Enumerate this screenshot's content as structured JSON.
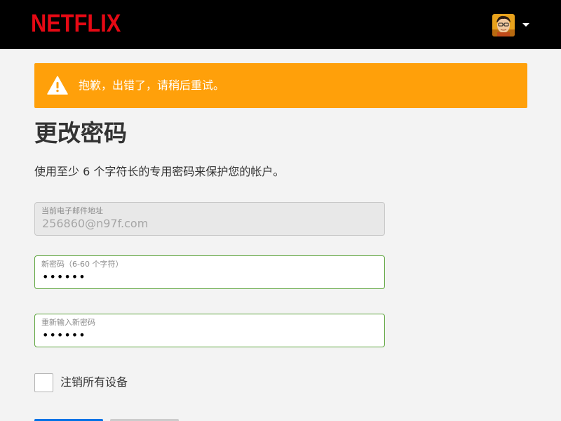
{
  "header": {
    "logo_text": "NETFLIX",
    "logo_color": "#e50914",
    "avatar_icon": "profile-avatar",
    "caret_icon": "caret-down-icon"
  },
  "alert": {
    "icon": "warning-icon",
    "message": "抱歉，出错了，请稍后重试。",
    "color": "#ffa00a"
  },
  "page": {
    "title": "更改密码",
    "subtitle": "使用至少 6 个字符长的专用密码来保护您的帐户。"
  },
  "form": {
    "email_label": "当前电子邮件地址",
    "email_value": "256860@n97f.com",
    "new_password_label": "新密码（6-60 个字符）",
    "new_password_value": "••••••",
    "confirm_password_label": "重新输入新密码",
    "confirm_password_value": "••••••",
    "signout_all_label": "注销所有设备",
    "signout_all_checked": false
  },
  "colors": {
    "valid_border": "#5fa53f",
    "primary_button": "#0073e6"
  }
}
